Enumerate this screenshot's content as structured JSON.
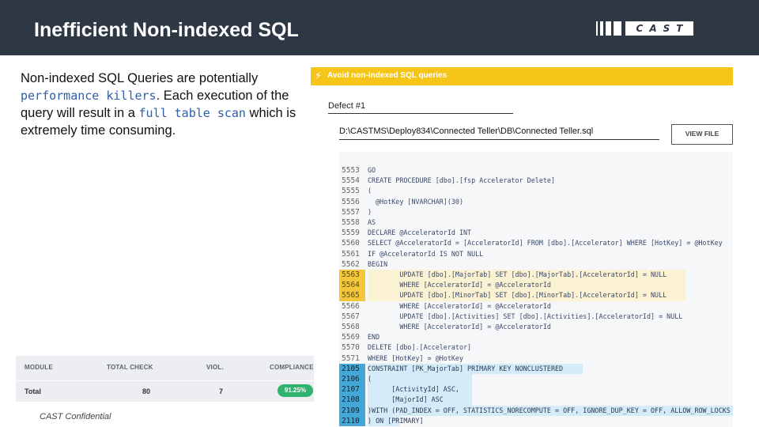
{
  "slide": {
    "title": "Inefficient Non-indexed SQL",
    "logo_text": "CAST",
    "confidential": "CAST Confidential"
  },
  "description": {
    "part1": "Non-indexed SQL Queries are potentially ",
    "term1": "performance killers",
    "part2": ". Each execution of the query will result in a ",
    "term2": "full table scan",
    "part3": " which is extremely time consuming."
  },
  "summary": {
    "headers": [
      "MODULE",
      "TOTAL CHECK",
      "VIOL.",
      "COMPLIANCE"
    ],
    "row": {
      "module": "Total",
      "total_check": "80",
      "violations": "7",
      "compliance": "91.25%"
    }
  },
  "rule": {
    "banner": "Avoid non-indexed SQL queries",
    "icon": "lightning-bolt-icon",
    "defect_label": "Defect #1",
    "file_path": "D:\\CASTMS\\Deploy834\\Connected Teller\\DB\\Connected Teller.sql",
    "view_button": "VIEW FILE"
  },
  "colors": {
    "header_bg": "#2e3744",
    "banner": "#f5c518",
    "highlight_yellow": "#f3c63b",
    "highlight_blue": "#43a8d8",
    "compliance_badge": "#2fb36f",
    "inline_code": "#2d5ea8"
  },
  "code_lines": [
    {
      "n": "5553",
      "t": "GO",
      "hl": ""
    },
    {
      "n": "5554",
      "t": "CREATE PROCEDURE [dbo].[fsp Accelerator Delete]",
      "hl": ""
    },
    {
      "n": "5555",
      "t": "(",
      "hl": ""
    },
    {
      "n": "5556",
      "t": "  @HotKey [NVARCHAR](30)",
      "hl": ""
    },
    {
      "n": "5557",
      "t": ")",
      "hl": ""
    },
    {
      "n": "5558",
      "t": "AS",
      "hl": ""
    },
    {
      "n": "5559",
      "t": "DECLARE @AcceleratorId INT",
      "hl": ""
    },
    {
      "n": "5560",
      "t": "SELECT @AcceleratorId = [AcceleratorId] FROM [dbo].[Accelerator] WHERE [HotKey] = @HotKey",
      "hl": ""
    },
    {
      "n": "5561",
      "t": "IF @AcceleratorId IS NOT NULL",
      "hl": ""
    },
    {
      "n": "5562",
      "t": "BEGIN",
      "hl": ""
    },
    {
      "n": "5563",
      "t": "        UPDATE [dbo].[MajorTab] SET [dbo].[MajorTab].[AcceleratorId] = NULL",
      "hl": "y"
    },
    {
      "n": "5564",
      "t": "        WHERE [AcceleratorId] = @AcceleratorId",
      "hl": "y"
    },
    {
      "n": "5565",
      "t": "        UPDATE [dbo].[MinorTab] SET [dbo].[MinorTab].[AcceleratorId] = NULL",
      "hl": "y"
    },
    {
      "n": "5566",
      "t": "        WHERE [AcceleratorId] = @AcceleratorId",
      "hl": ""
    },
    {
      "n": "5567",
      "t": "        UPDATE [dbo].[Activities] SET [dbo].[Activities].[AcceleratorId] = NULL",
      "hl": ""
    },
    {
      "n": "5568",
      "t": "        WHERE [AcceleratorId] = @AcceleratorId",
      "hl": ""
    },
    {
      "n": "5569",
      "t": "END",
      "hl": ""
    },
    {
      "n": "5570",
      "t": "DELETE [dbo].[Accelerator]",
      "hl": ""
    },
    {
      "n": "5571",
      "t": "WHERE [HotKey] = @HotKey",
      "hl": ""
    },
    {
      "n": "2105",
      "t": "CONSTRAINT [PK_MajorTab] PRIMARY KEY NONCLUSTERED",
      "hl": "b"
    },
    {
      "n": "2106",
      "t": "(",
      "hl": "b"
    },
    {
      "n": "2107",
      "t": "      [ActivityId] ASC,",
      "hl": "b"
    },
    {
      "n": "2108",
      "t": "      [MajorId] ASC",
      "hl": "b"
    },
    {
      "n": "2109",
      "t": ")WITH (PAD_INDEX = OFF, STATISTICS_NORECOMPUTE = OFF, IGNORE_DUP_KEY = OFF, ALLOW_ROW_LOCKS",
      "hl": "b"
    },
    {
      "n": "2110",
      "t": ") ON [PRIMARY]",
      "hl": "b"
    }
  ]
}
